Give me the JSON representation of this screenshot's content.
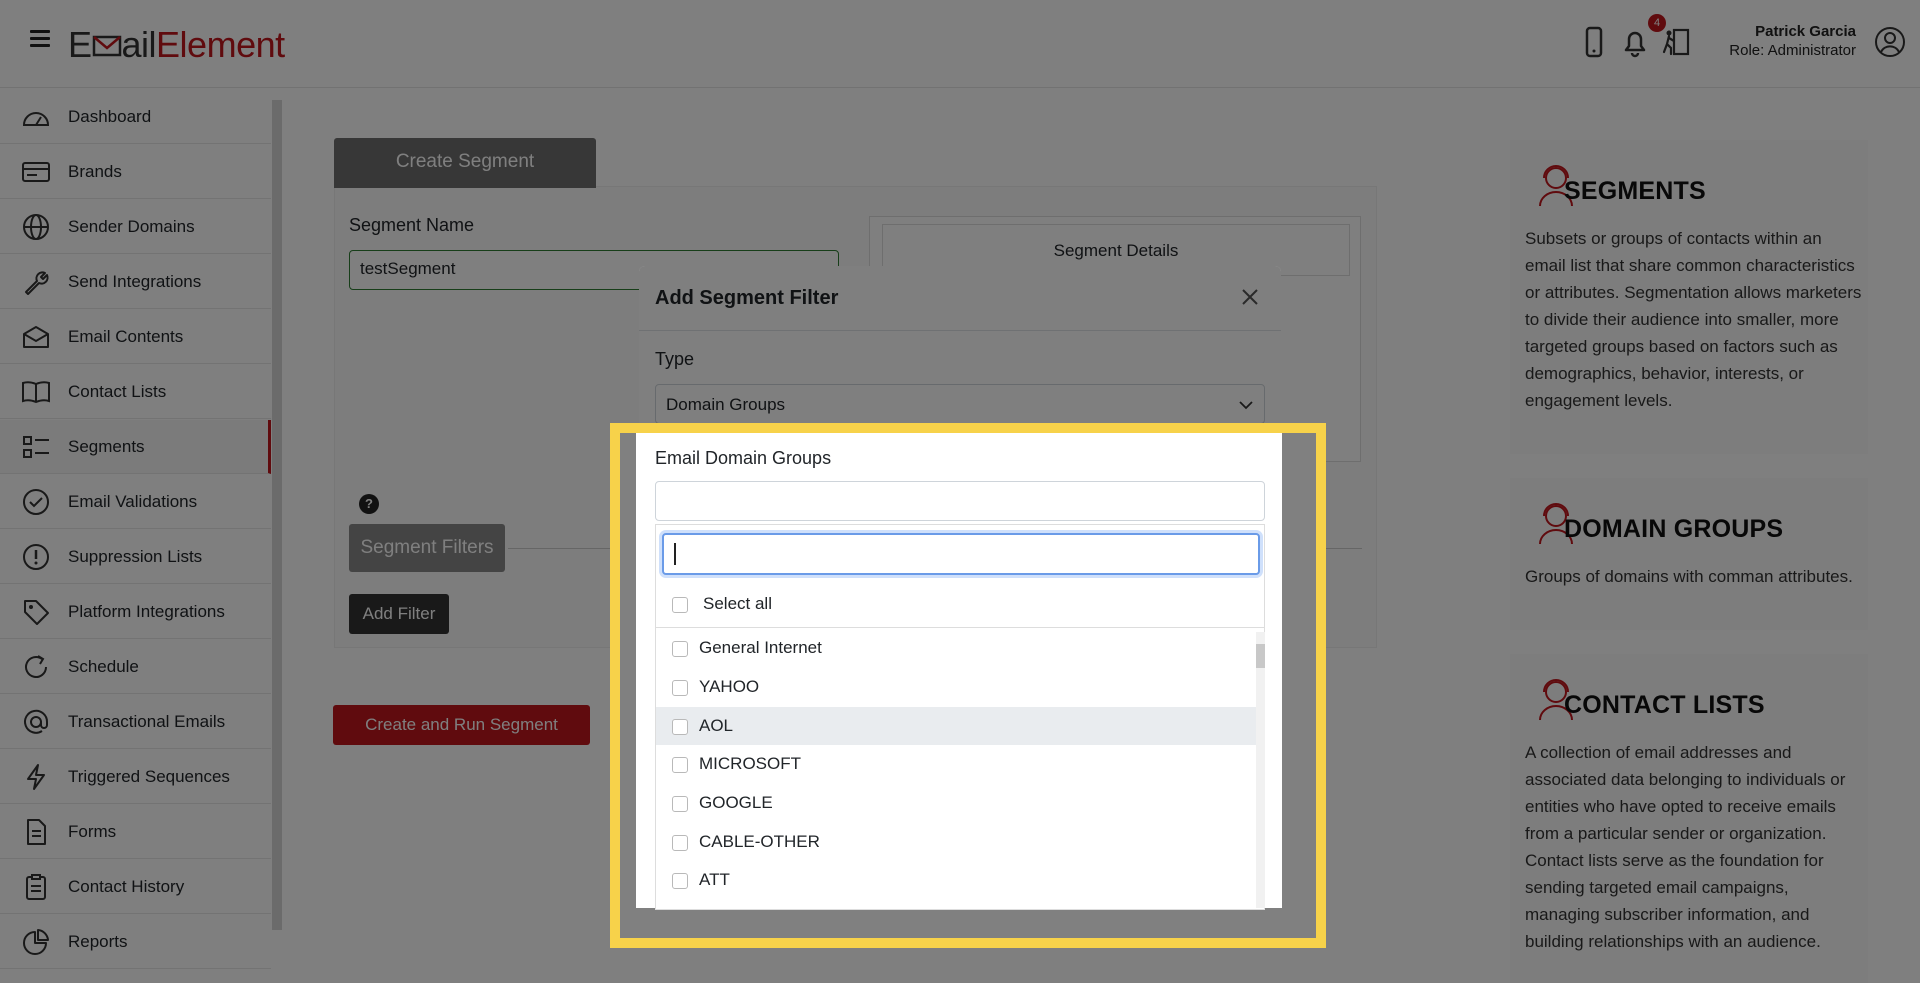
{
  "header": {
    "logo_part1": "E",
    "logo_part2": "ail",
    "logo_part3": "Element",
    "notification_count": "4",
    "user_name": "Patrick Garcia",
    "user_role": "Role: Administrator"
  },
  "sidebar": {
    "items": [
      {
        "label": "Dashboard",
        "icon": "dashboard-icon"
      },
      {
        "label": "Brands",
        "icon": "brands-icon"
      },
      {
        "label": "Sender Domains",
        "icon": "globe-icon"
      },
      {
        "label": "Send Integrations",
        "icon": "wrench-icon"
      },
      {
        "label": "Email Contents",
        "icon": "envelope-icon"
      },
      {
        "label": "Contact Lists",
        "icon": "book-icon"
      },
      {
        "label": "Segments",
        "icon": "segments-icon"
      },
      {
        "label": "Email Validations",
        "icon": "check-circle-icon"
      },
      {
        "label": "Suppression Lists",
        "icon": "exclamation-circle-icon"
      },
      {
        "label": "Platform Integrations",
        "icon": "tag-icon"
      },
      {
        "label": "Schedule",
        "icon": "schedule-icon"
      },
      {
        "label": "Transactional Emails",
        "icon": "at-icon"
      },
      {
        "label": "Triggered Sequences",
        "icon": "lightning-icon"
      },
      {
        "label": "Forms",
        "icon": "document-icon"
      },
      {
        "label": "Contact History",
        "icon": "clipboard-icon"
      },
      {
        "label": "Reports",
        "icon": "pie-chart-icon"
      }
    ],
    "active": "Segments"
  },
  "main": {
    "tab_label": "Create Segment",
    "segment_name_label": "Segment Name",
    "segment_name_value": "testSegment",
    "segment_details_label": "Segment Details",
    "help_label": "?",
    "segment_filters_label": "Segment Filters",
    "add_filter_label": "Add Filter",
    "create_run_label": "Create and Run Segment"
  },
  "info": {
    "segments_title": "SEGMENTS",
    "segments_text": "Subsets or groups of contacts within an email list that share common characteristics or attributes. Segmentation allows marketers to divide their audience into smaller, more targeted groups based on factors such as demographics, behavior, interests, or engagement levels.",
    "domain_groups_title": "DOMAIN GROUPS",
    "domain_groups_text": "Groups of domains with comman attributes.",
    "contact_lists_title": "CONTACT LISTS",
    "contact_lists_text": "A collection of email addresses and associated data belonging to individuals or entities who have opted to receive emails from a particular sender or organization. Contact lists serve as the foundation for sending targeted email campaigns, managing subscriber information, and building relationships with an audience."
  },
  "modal": {
    "title": "Add Segment Filter",
    "type_label": "Type",
    "type_value": "Domain Groups",
    "domain_groups_label": "Email Domain Groups",
    "search_value": "",
    "select_all_label": "Select all",
    "options": [
      "General Internet",
      "YAHOO",
      "AOL",
      "MICROSOFT",
      "GOOGLE",
      "CABLE-OTHER",
      "ATT"
    ],
    "hovered_option": "AOL"
  },
  "colors": {
    "brand_red": "#c0161d",
    "highlight_yellow": "#f7d24a"
  }
}
